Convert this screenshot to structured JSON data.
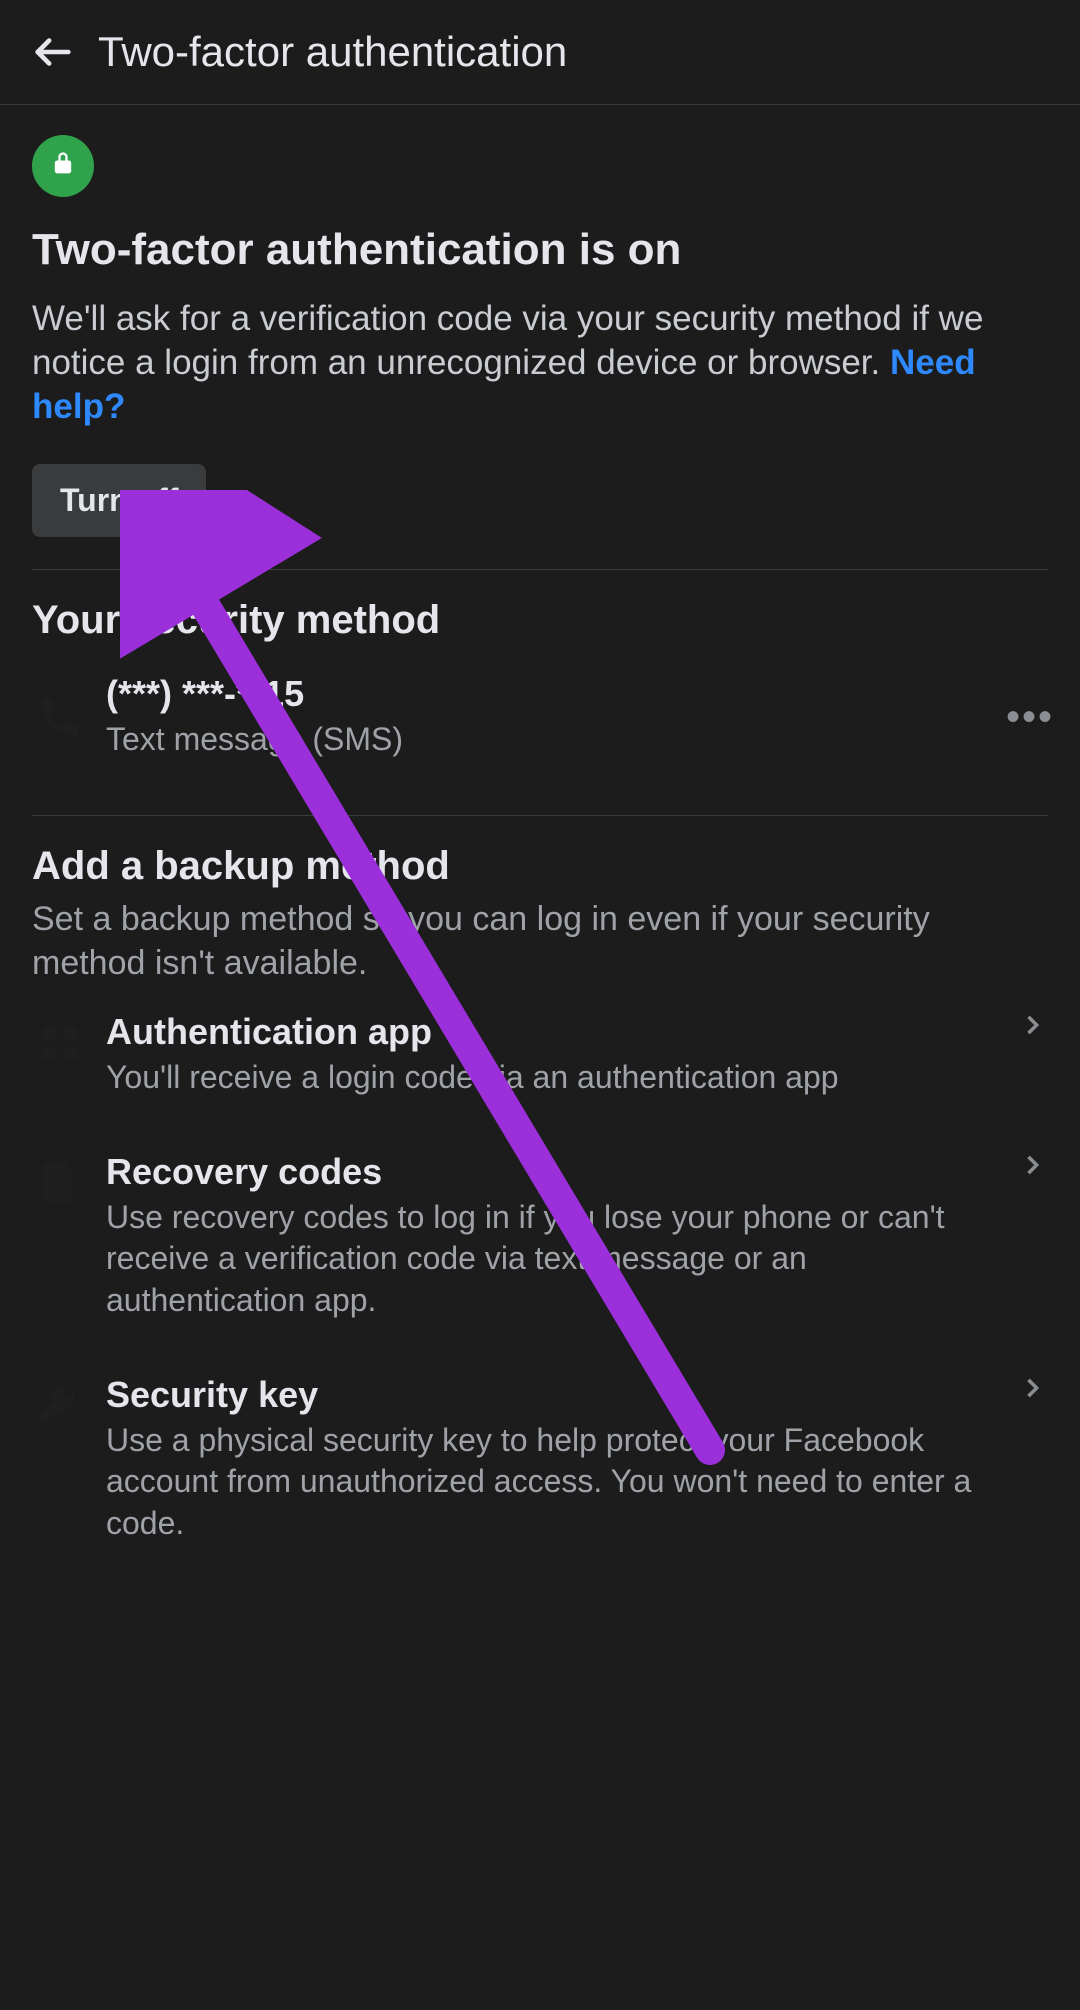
{
  "header": {
    "title": "Two-factor authentication"
  },
  "status": {
    "heading": "Two-factor authentication is on",
    "description": "We'll ask for a verification code via your security method if we notice a login from an unrecognized device or browser. ",
    "help_link": "Need help?",
    "turn_off_label": "Turn off"
  },
  "method_section": {
    "heading": "Your security method",
    "item": {
      "phone": "(***) ***-**15",
      "label": "Text message (SMS)"
    }
  },
  "backup_section": {
    "heading": "Add a backup method",
    "description": "Set a backup method so you can log in even if your security method isn't available.",
    "items": [
      {
        "title": "Authentication app",
        "sub": "You'll receive a login code via an authentication app"
      },
      {
        "title": "Recovery codes",
        "sub": "Use recovery codes to log in if you lose your phone or can't receive a verification code via text message or an authentication app."
      },
      {
        "title": "Security key",
        "sub": "Use a physical security key to help protect your Facebook account from unauthorized access. You won't need to enter a code."
      }
    ]
  },
  "annotation": {
    "arrow_color": "#9b2fd9"
  }
}
